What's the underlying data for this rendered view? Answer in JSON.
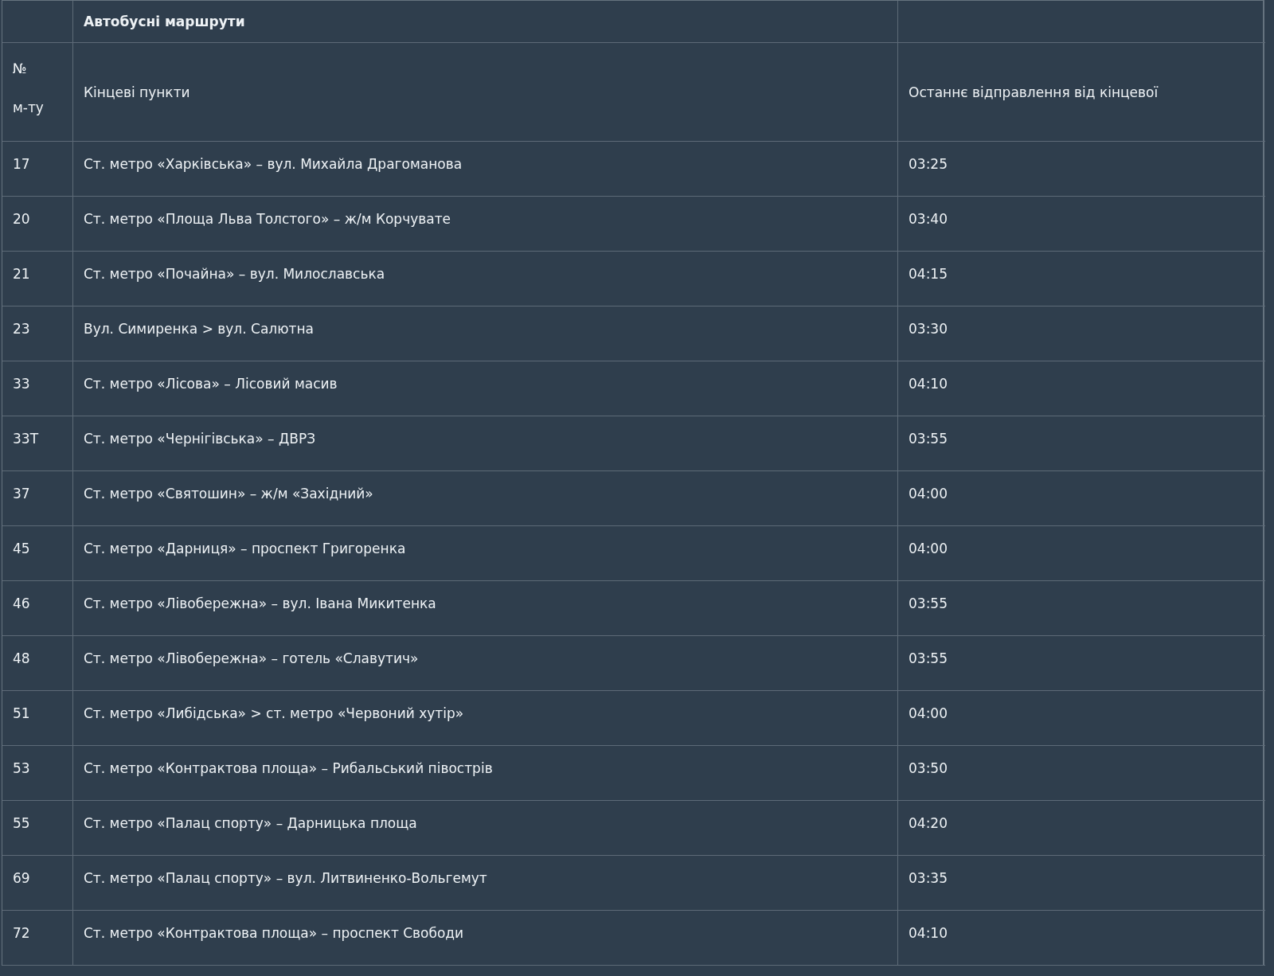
{
  "table": {
    "title": "Автобусні маршрути",
    "columns": [
      "№\nм-ту",
      "Кінцеві пункти",
      "Останнє відправлення від кінцевої"
    ],
    "rows": [
      {
        "number": "17",
        "endpoints": "Ст. метро «Харківська» – вул. Михайла Драгоманова",
        "last_departure": "03:25"
      },
      {
        "number": "20",
        "endpoints": "Ст. метро «Площа Льва Толстого» – ж/м Корчувате",
        "last_departure": "03:40"
      },
      {
        "number": "21",
        "endpoints": "Ст. метро «Почайна» – вул. Милославська",
        "last_departure": "04:15"
      },
      {
        "number": "23",
        "endpoints": "Вул. Симиренка > вул. Салютна",
        "last_departure": "03:30"
      },
      {
        "number": "33",
        "endpoints": "Ст. метро «Лісова» – Лісовий масив",
        "last_departure": "04:10"
      },
      {
        "number": "33Т",
        "endpoints": "Ст. метро «Чернігівська» – ДВРЗ",
        "last_departure": "03:55"
      },
      {
        "number": "37",
        "endpoints": "Ст. метро «Святошин» – ж/м «Західний»",
        "last_departure": "04:00"
      },
      {
        "number": "45",
        "endpoints": "Ст. метро «Дарниця» – проспект Григоренка",
        "last_departure": "04:00"
      },
      {
        "number": "46",
        "endpoints": "Ст. метро «Лівобережна» – вул. Івана Микитенка",
        "last_departure": "03:55"
      },
      {
        "number": "48",
        "endpoints": "Ст. метро «Лівобережна» – готель «Славутич»",
        "last_departure": "03:55"
      },
      {
        "number": "51",
        "endpoints": "Ст. метро «Либідська» > ст. метро «Червоний хутір»",
        "last_departure": "04:00"
      },
      {
        "number": "53",
        "endpoints": "Ст. метро «Контрактова площа» – Рибальський півострів",
        "last_departure": "03:50"
      },
      {
        "number": "55",
        "endpoints": "Ст. метро «Палац спорту» – Дарницька площа",
        "last_departure": "04:20"
      },
      {
        "number": "69",
        "endpoints": "Ст. метро «Палац спорту» – вул. Литвиненко-Вольгемут",
        "last_departure": "03:35"
      },
      {
        "number": "72",
        "endpoints": "Ст. метро «Контрактова площа» – проспект Свободи",
        "last_departure": "04:10"
      }
    ]
  }
}
